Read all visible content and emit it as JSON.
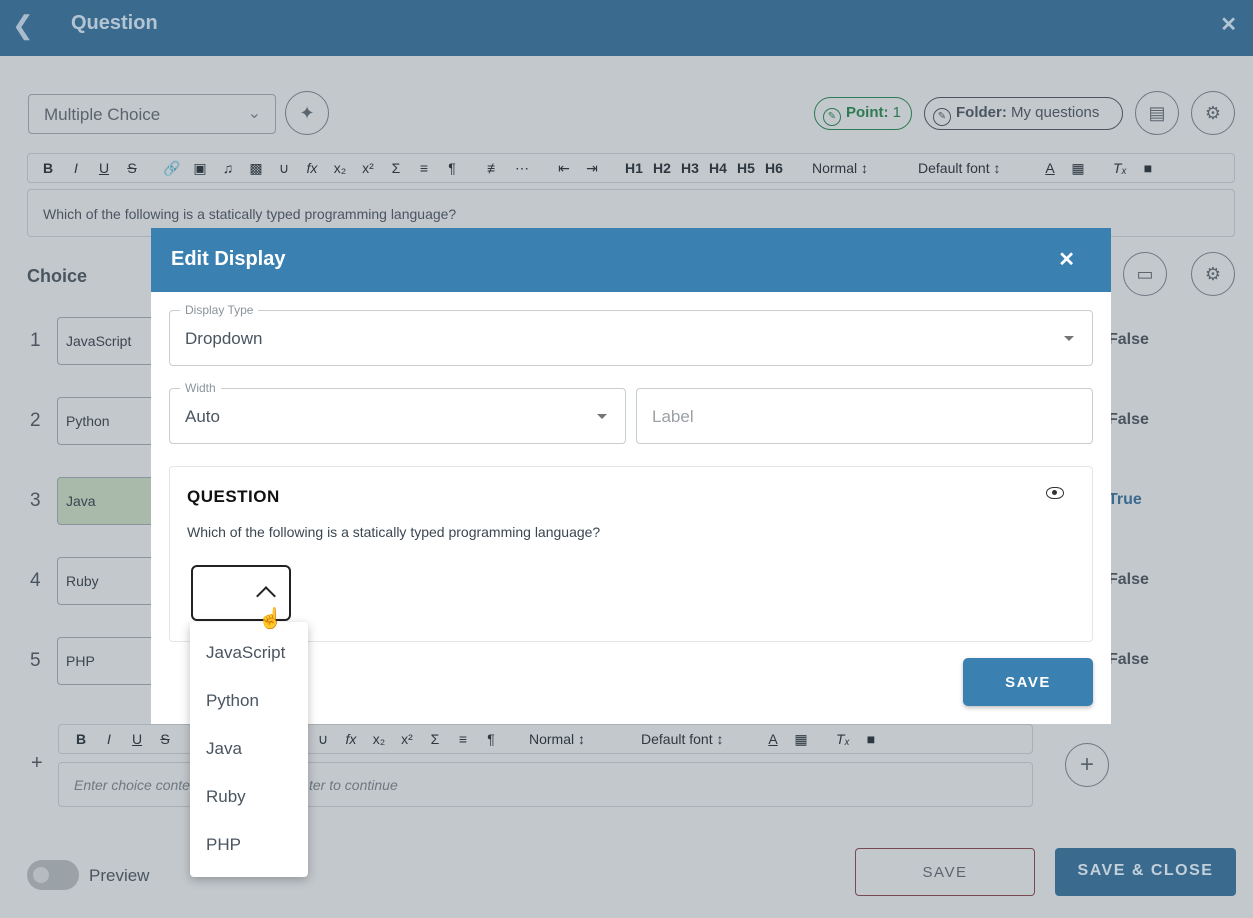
{
  "header": {
    "title": "Question"
  },
  "question_type": {
    "value": "Multiple Choice"
  },
  "badges": {
    "point_label": "Point:",
    "point_value": "1",
    "folder_label": "Folder:",
    "folder_value": "My questions"
  },
  "toolbar": {
    "font_size": "Normal",
    "font_family": "Default font",
    "headings": [
      "H1",
      "H2",
      "H3",
      "H4",
      "H5",
      "H6"
    ]
  },
  "question": {
    "text": "Which of the following is a statically typed programming language?"
  },
  "choices": {
    "title": "Choice",
    "items": [
      {
        "number": "1",
        "text": "JavaScript",
        "status": "False"
      },
      {
        "number": "2",
        "text": "Python",
        "status": "False"
      },
      {
        "number": "3",
        "text": "Java",
        "status": "True"
      },
      {
        "number": "4",
        "text": "Ruby",
        "status": "False"
      },
      {
        "number": "5",
        "text": "PHP",
        "status": "False"
      }
    ],
    "input_placeholder_left": "Enter choice conte",
    "input_placeholder_right": "ter to continue"
  },
  "preview": {
    "label": "Preview"
  },
  "footer": {
    "save_label": "SAVE",
    "save_close_label": "SAVE & CLOSE"
  },
  "modal": {
    "title": "Edit Display",
    "display_type": {
      "label": "Display Type",
      "value": "Dropdown"
    },
    "width": {
      "label": "Width",
      "value": "Auto"
    },
    "label_placeholder": "Label",
    "preview_title": "QUESTION",
    "preview_text": "Which of the following is a statically typed programming language?",
    "save_label": "SAVE",
    "dropdown_options": [
      "JavaScript",
      "Python",
      "Java",
      "Ruby",
      "PHP"
    ]
  },
  "colors": {
    "primary": "#3a80b0",
    "dim_primary": "#3a6a8e",
    "point_green": "#2e7a52"
  }
}
